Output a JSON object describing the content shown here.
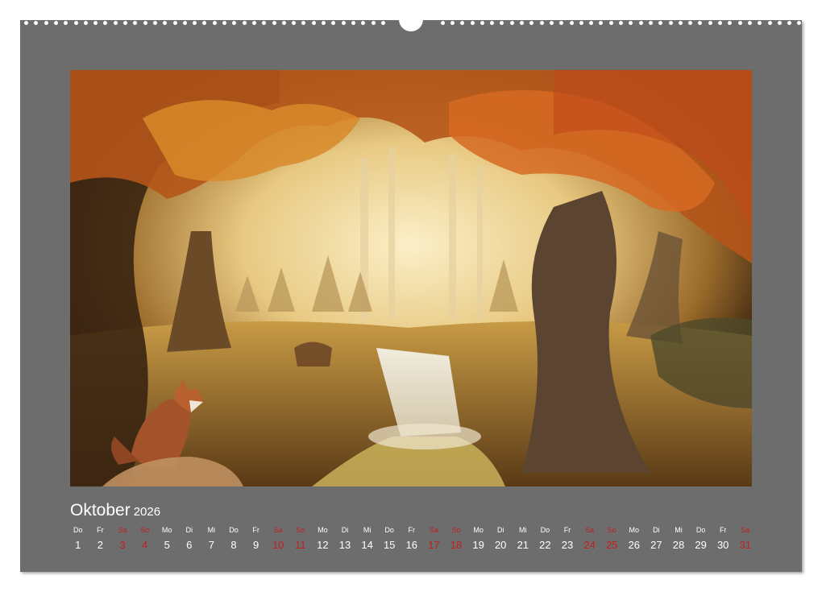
{
  "calendar": {
    "month": "Oktober",
    "year": "2026",
    "days": [
      {
        "wd": "Do",
        "n": "1",
        "we": false
      },
      {
        "wd": "Fr",
        "n": "2",
        "we": false
      },
      {
        "wd": "Sa",
        "n": "3",
        "we": true
      },
      {
        "wd": "So",
        "n": "4",
        "we": true
      },
      {
        "wd": "Mo",
        "n": "5",
        "we": false
      },
      {
        "wd": "Di",
        "n": "6",
        "we": false
      },
      {
        "wd": "Mi",
        "n": "7",
        "we": false
      },
      {
        "wd": "Do",
        "n": "8",
        "we": false
      },
      {
        "wd": "Fr",
        "n": "9",
        "we": false
      },
      {
        "wd": "Sa",
        "n": "10",
        "we": true
      },
      {
        "wd": "So",
        "n": "11",
        "we": true
      },
      {
        "wd": "Mo",
        "n": "12",
        "we": false
      },
      {
        "wd": "Di",
        "n": "13",
        "we": false
      },
      {
        "wd": "Mi",
        "n": "14",
        "we": false
      },
      {
        "wd": "Do",
        "n": "15",
        "we": false
      },
      {
        "wd": "Fr",
        "n": "16",
        "we": false
      },
      {
        "wd": "Sa",
        "n": "17",
        "we": true
      },
      {
        "wd": "So",
        "n": "18",
        "we": true
      },
      {
        "wd": "Mo",
        "n": "19",
        "we": false
      },
      {
        "wd": "Di",
        "n": "20",
        "we": false
      },
      {
        "wd": "Mi",
        "n": "21",
        "we": false
      },
      {
        "wd": "Do",
        "n": "22",
        "we": false
      },
      {
        "wd": "Fr",
        "n": "23",
        "we": false
      },
      {
        "wd": "Sa",
        "n": "24",
        "we": true
      },
      {
        "wd": "So",
        "n": "25",
        "we": true
      },
      {
        "wd": "Mo",
        "n": "26",
        "we": false
      },
      {
        "wd": "Di",
        "n": "27",
        "we": false
      },
      {
        "wd": "Mi",
        "n": "28",
        "we": false
      },
      {
        "wd": "Do",
        "n": "29",
        "we": false
      },
      {
        "wd": "Fr",
        "n": "30",
        "we": false
      },
      {
        "wd": "Sa",
        "n": "31",
        "we": true
      }
    ]
  },
  "colors": {
    "page_background": "#6d6d6d",
    "text": "#ffffff",
    "weekend": "#c0201e"
  },
  "photo": {
    "icon": "autumn-forest-waterfall-fox-illustration"
  }
}
